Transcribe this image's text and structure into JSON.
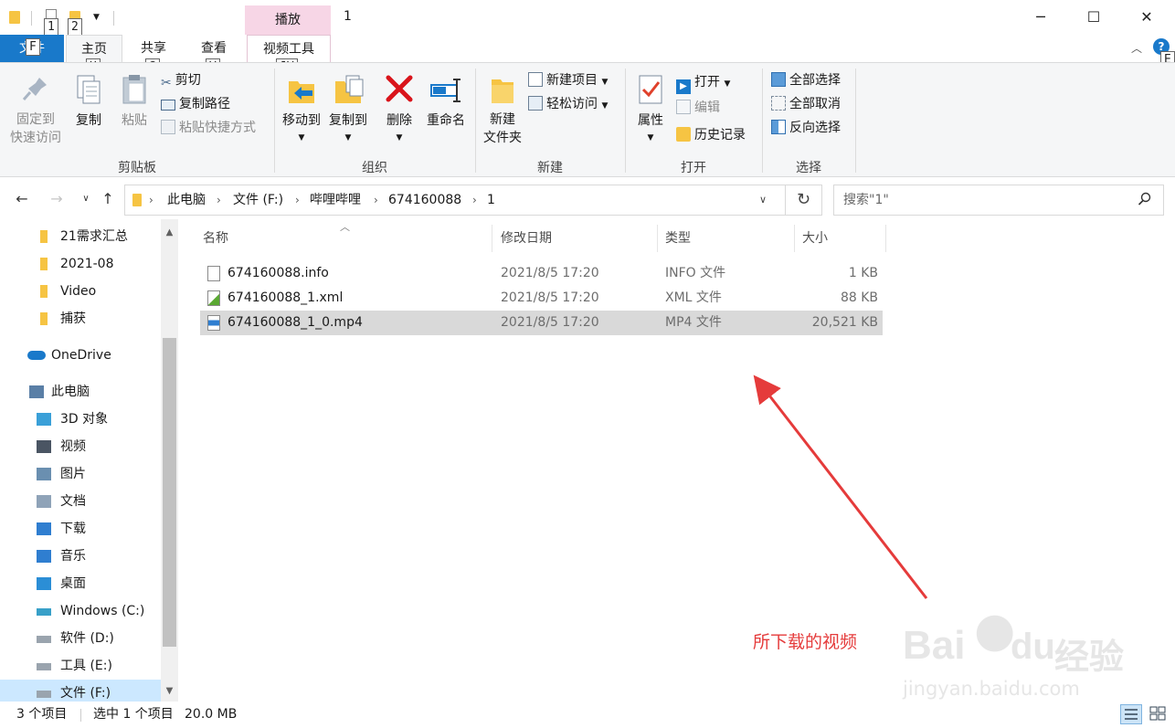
{
  "window": {
    "title": "1",
    "context_tab": "播放",
    "keytips": {
      "qa1": "1",
      "qa2": "2",
      "file": "F",
      "home": "H",
      "share": "S",
      "view": "V",
      "video_tools": "JV",
      "help": "E"
    }
  },
  "tabs": [
    "文件",
    "主页",
    "共享",
    "查看",
    "视频工具"
  ],
  "help_label": "?",
  "ribbon": {
    "clipboard": {
      "label": "剪贴板",
      "pin": "固定到\n快速访问",
      "copy": "复制",
      "paste": "粘贴",
      "cut": "剪切",
      "copy_path": "复制路径",
      "paste_shortcut": "粘贴快捷方式"
    },
    "organize": {
      "label": "组织",
      "move_to": "移动到",
      "copy_to": "复制到",
      "delete": "删除",
      "rename": "重命名"
    },
    "new": {
      "label": "新建",
      "new_folder": "新建\n文件夹",
      "new_item": "新建项目",
      "easy_access": "轻松访问"
    },
    "open": {
      "label": "打开",
      "properties": "属性",
      "open": "打开",
      "edit": "编辑",
      "history": "历史记录"
    },
    "select": {
      "label": "选择",
      "select_all": "全部选择",
      "select_none": "全部取消",
      "invert": "反向选择"
    }
  },
  "address": {
    "crumbs": [
      "此电脑",
      "文件 (F:)",
      "哔哩哔哩",
      "674160088",
      "1"
    ],
    "search_placeholder": "搜索\"1\""
  },
  "nav_pane": {
    "items": [
      {
        "label": "21需求汇总",
        "icon": "folder-icon"
      },
      {
        "label": "2021-08",
        "icon": "folder-icon"
      },
      {
        "label": "Video",
        "icon": "folder-icon"
      },
      {
        "label": "捕获",
        "icon": "folder-icon"
      },
      {
        "label": "OneDrive",
        "icon": "onedrive-icon"
      },
      {
        "label": "此电脑",
        "icon": "computer-icon"
      },
      {
        "label": "3D 对象",
        "icon": "3d-objects-icon"
      },
      {
        "label": "视频",
        "icon": "videos-icon"
      },
      {
        "label": "图片",
        "icon": "pictures-icon"
      },
      {
        "label": "文档",
        "icon": "documents-icon"
      },
      {
        "label": "下载",
        "icon": "downloads-icon"
      },
      {
        "label": "音乐",
        "icon": "music-icon"
      },
      {
        "label": "桌面",
        "icon": "desktop-icon"
      },
      {
        "label": "Windows (C:)",
        "icon": "drive-c-icon"
      },
      {
        "label": "软件 (D:)",
        "icon": "drive-icon"
      },
      {
        "label": "工具 (E:)",
        "icon": "drive-icon"
      },
      {
        "label": "文件 (F:)",
        "icon": "drive-icon"
      }
    ]
  },
  "file_list": {
    "columns": [
      "名称",
      "修改日期",
      "类型",
      "大小"
    ],
    "rows": [
      {
        "name": "674160088.info",
        "date": "2021/8/5 17:20",
        "type": "INFO 文件",
        "size": "1 KB",
        "icon": "file-icon"
      },
      {
        "name": "674160088_1.xml",
        "date": "2021/8/5 17:20",
        "type": "XML 文件",
        "size": "88 KB",
        "icon": "xml-file-icon"
      },
      {
        "name": "674160088_1_0.mp4",
        "date": "2021/8/5 17:20",
        "type": "MP4 文件",
        "size": "20,521 KB",
        "icon": "video-file-icon",
        "selected": true
      }
    ]
  },
  "status": {
    "count": "3 个项目",
    "selection": "选中 1 个项目",
    "size": "20.0 MB"
  },
  "annotation": "所下载的视频",
  "watermark": {
    "brand": "Bai",
    "brand2": "du",
    "cn": "经验",
    "url": "jingyan.baidu.com"
  },
  "colors": {
    "accent": "#1979ca",
    "annotation": "#e53b3b",
    "selected_row": "#d9d9d9",
    "context_tab": "#f7d6e6"
  }
}
